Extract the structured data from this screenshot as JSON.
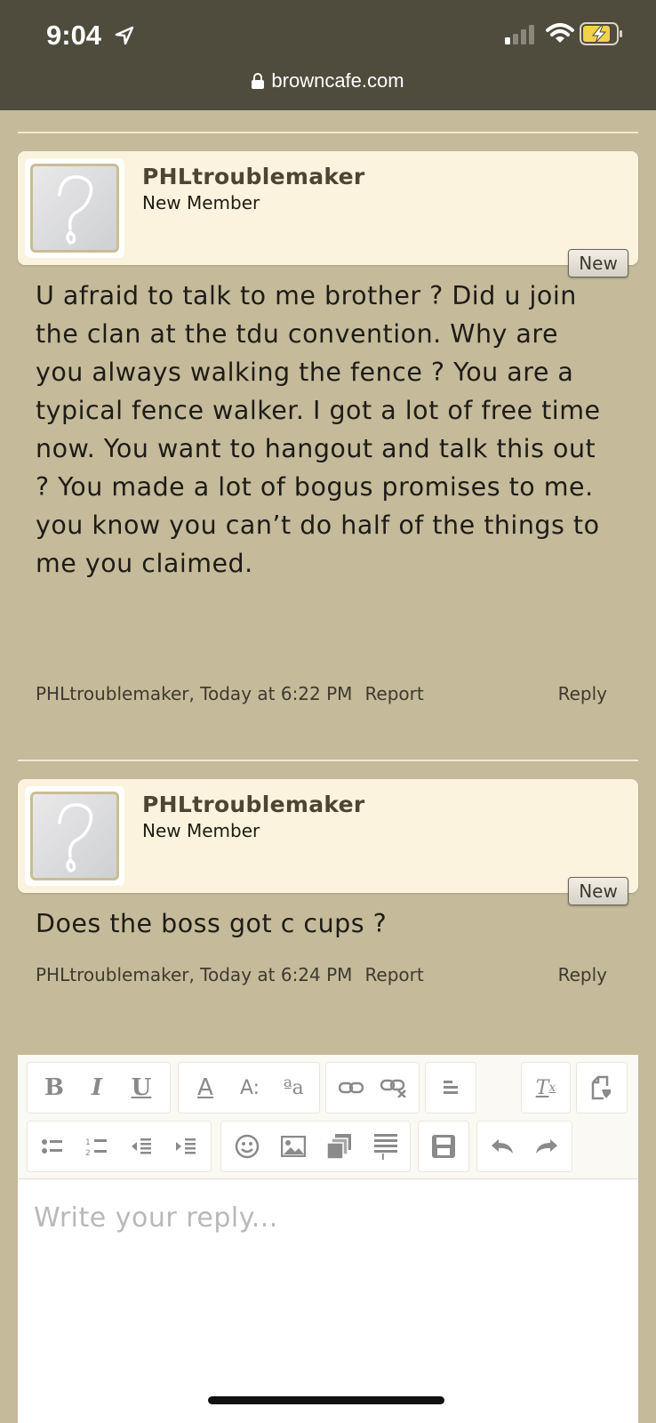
{
  "status_bar": {
    "time": "9:04",
    "url": "browncafe.com"
  },
  "posts": [
    {
      "username": "PHLtroublemaker",
      "role": "New Member",
      "badge": "New",
      "body": "U afraid to talk to me brother ? Did u join the clan at the tdu convention. Why are you always walking the fence ? You are a typical fence walker. I got a lot of free time now. You want to hangout and talk this out ? You made a lot of bogus promises to me. you know you can’t do half of the things to me you claimed.",
      "meta": "PHLtroublemaker, Today at 6:22 PM",
      "report_label": "Report",
      "reply_label": "Reply"
    },
    {
      "username": "PHLtroublemaker",
      "role": "New Member",
      "badge": "New",
      "body": "Does the boss got c cups ?",
      "meta": "PHLtroublemaker, Today at 6:24 PM",
      "report_label": "Report",
      "reply_label": "Reply"
    }
  ],
  "editor": {
    "placeholder": "Write your reply...",
    "toolbar_row1": [
      {
        "icon": "bold-icon",
        "glyph": "B"
      },
      {
        "icon": "italic-icon",
        "glyph": "I"
      },
      {
        "icon": "underline-icon",
        "glyph": "U"
      },
      {
        "icon": "font-color-icon",
        "glyph": "A"
      },
      {
        "icon": "font-size-icon",
        "glyph": "A:"
      },
      {
        "icon": "font-family-icon",
        "glyph": "ªa"
      },
      {
        "icon": "link-icon",
        "glyph": ""
      },
      {
        "icon": "unlink-icon",
        "glyph": ""
      },
      {
        "icon": "align-icon",
        "glyph": ""
      },
      {
        "icon": "remove-format-icon",
        "glyph": "Tx"
      },
      {
        "icon": "toggle-bbcode-icon",
        "glyph": ""
      }
    ],
    "toolbar_row2": [
      {
        "icon": "bullet-list-icon"
      },
      {
        "icon": "numbered-list-icon"
      },
      {
        "icon": "outdent-icon"
      },
      {
        "icon": "indent-icon"
      },
      {
        "icon": "smilies-icon"
      },
      {
        "icon": "image-icon"
      },
      {
        "icon": "media-icon"
      },
      {
        "icon": "insert-icon"
      },
      {
        "icon": "save-draft-icon"
      },
      {
        "icon": "undo-icon"
      },
      {
        "icon": "redo-icon"
      }
    ]
  },
  "colors": {
    "page_bg": "#c5ba9a",
    "status_bar_bg": "#4f4b3d",
    "post_header_bg": "#fbf3de",
    "username_color": "#4d4432",
    "battery_fill": "#f2d24b"
  }
}
